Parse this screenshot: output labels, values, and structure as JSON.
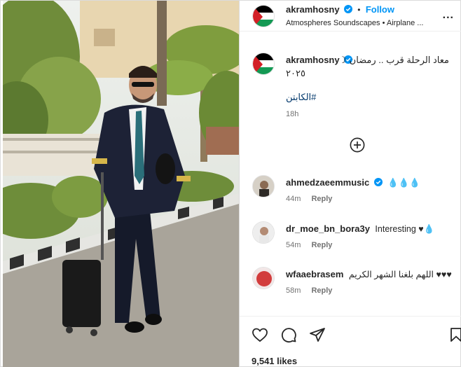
{
  "post": {
    "username": "akramhosny",
    "follow_label": "Follow",
    "subtitle": "Atmospheres Soundscapes • Airplane ...",
    "more_label": "...",
    "caption_line1": "معاد الرحلة قرب .. رمضان ☽",
    "caption_line2": "٢٠٢٥",
    "hashtag": "#الكابتن",
    "time": "18h",
    "likes": "9,541 likes"
  },
  "comments": [
    {
      "username": "ahmedzaeemmusic",
      "text": "💧💧💧",
      "time": "44m",
      "reply": "Reply",
      "verified": true
    },
    {
      "username": "dr_moe_bn_bora3y",
      "text": "Interesting ♥💧",
      "time": "54m",
      "reply": "Reply",
      "verified": false
    },
    {
      "username": "wfaaebrasem",
      "text": "اللهم بلغنا الشهر الكريم ♥♥♥",
      "time": "58m",
      "reply": "Reply",
      "verified": false
    }
  ],
  "colors": {
    "accent": "#0095f6",
    "verified": "#0095f6",
    "flag_black": "#000000",
    "flag_white": "#ffffff",
    "flag_green": "#149954",
    "flag_red": "#d32027"
  },
  "icons": [
    "heart-icon",
    "comment-icon",
    "share-icon",
    "bookmark-icon",
    "add-comment-icon",
    "verified-icon"
  ]
}
